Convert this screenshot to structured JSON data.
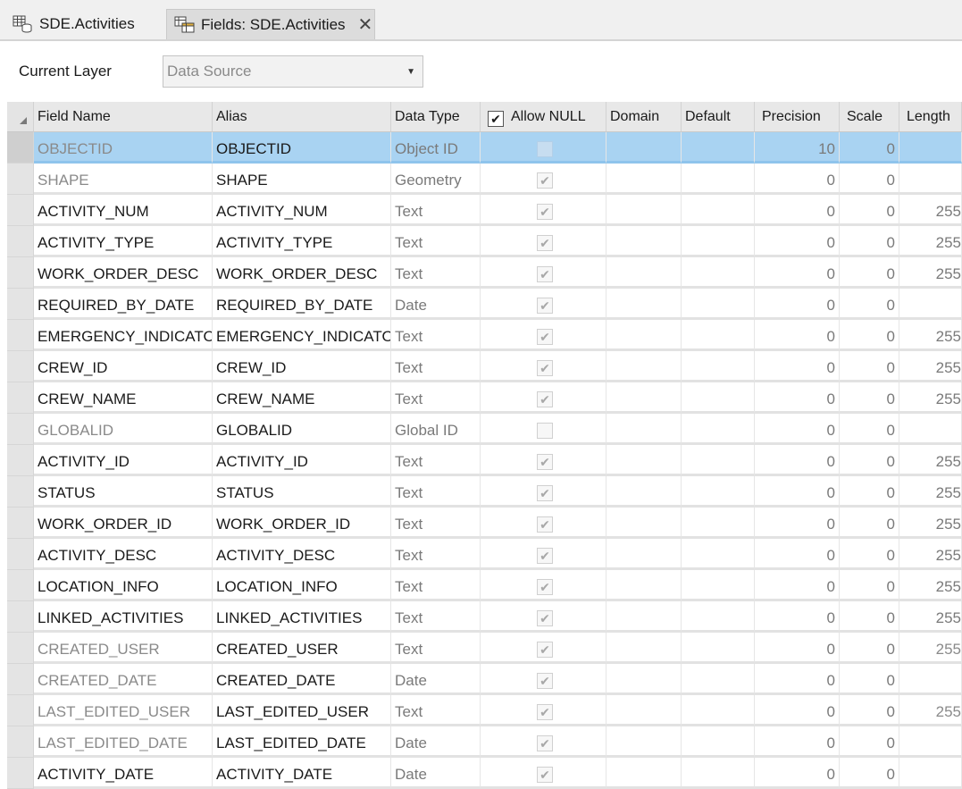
{
  "tabs": [
    {
      "label": "SDE.Activities",
      "icon": "table-icon",
      "active": false
    },
    {
      "label": "Fields: SDE.Activities",
      "icon": "fields-view-icon",
      "active": true,
      "close_icon": "close-icon"
    }
  ],
  "layer": {
    "label": "Current Layer",
    "value": "Data Source"
  },
  "grid": {
    "columns": [
      "Field Name",
      "Alias",
      "Data Type",
      "Allow NULL",
      "Domain",
      "Default",
      "Precision",
      "Scale",
      "Length"
    ],
    "header_allow_null_checked": true,
    "rows": [
      {
        "field": "OBJECTID",
        "alias": "OBJECTID",
        "type": "Object ID",
        "allow_null": false,
        "domain": "",
        "default": "",
        "precision": "10",
        "scale": "0",
        "length": "",
        "selected": true,
        "readonly": true
      },
      {
        "field": "SHAPE",
        "alias": "SHAPE",
        "type": "Geometry",
        "allow_null": true,
        "domain": "",
        "default": "",
        "precision": "0",
        "scale": "0",
        "length": "",
        "selected": false,
        "readonly": true
      },
      {
        "field": "ACTIVITY_NUM",
        "alias": "ACTIVITY_NUM",
        "type": "Text",
        "allow_null": true,
        "domain": "",
        "default": "",
        "precision": "0",
        "scale": "0",
        "length": "255",
        "selected": false,
        "readonly": false
      },
      {
        "field": "ACTIVITY_TYPE",
        "alias": "ACTIVITY_TYPE",
        "type": "Text",
        "allow_null": true,
        "domain": "",
        "default": "",
        "precision": "0",
        "scale": "0",
        "length": "255",
        "selected": false,
        "readonly": false
      },
      {
        "field": "WORK_ORDER_DESC",
        "alias": "WORK_ORDER_DESC",
        "type": "Text",
        "allow_null": true,
        "domain": "",
        "default": "",
        "precision": "0",
        "scale": "0",
        "length": "255",
        "selected": false,
        "readonly": false
      },
      {
        "field": "REQUIRED_BY_DATE",
        "alias": "REQUIRED_BY_DATE",
        "type": "Date",
        "allow_null": true,
        "domain": "",
        "default": "",
        "precision": "0",
        "scale": "0",
        "length": "",
        "selected": false,
        "readonly": false
      },
      {
        "field": "EMERGENCY_INDICATOR",
        "alias": "EMERGENCY_INDICATOR",
        "type": "Text",
        "allow_null": true,
        "domain": "",
        "default": "",
        "precision": "0",
        "scale": "0",
        "length": "255",
        "selected": false,
        "readonly": false
      },
      {
        "field": "CREW_ID",
        "alias": "CREW_ID",
        "type": "Text",
        "allow_null": true,
        "domain": "",
        "default": "",
        "precision": "0",
        "scale": "0",
        "length": "255",
        "selected": false,
        "readonly": false
      },
      {
        "field": "CREW_NAME",
        "alias": "CREW_NAME",
        "type": "Text",
        "allow_null": true,
        "domain": "",
        "default": "",
        "precision": "0",
        "scale": "0",
        "length": "255",
        "selected": false,
        "readonly": false
      },
      {
        "field": "GLOBALID",
        "alias": "GLOBALID",
        "type": "Global ID",
        "allow_null": false,
        "domain": "",
        "default": "",
        "precision": "0",
        "scale": "0",
        "length": "",
        "selected": false,
        "readonly": true
      },
      {
        "field": "ACTIVITY_ID",
        "alias": "ACTIVITY_ID",
        "type": "Text",
        "allow_null": true,
        "domain": "",
        "default": "",
        "precision": "0",
        "scale": "0",
        "length": "255",
        "selected": false,
        "readonly": false
      },
      {
        "field": "STATUS",
        "alias": "STATUS",
        "type": "Text",
        "allow_null": true,
        "domain": "",
        "default": "",
        "precision": "0",
        "scale": "0",
        "length": "255",
        "selected": false,
        "readonly": false
      },
      {
        "field": "WORK_ORDER_ID",
        "alias": "WORK_ORDER_ID",
        "type": "Text",
        "allow_null": true,
        "domain": "",
        "default": "",
        "precision": "0",
        "scale": "0",
        "length": "255",
        "selected": false,
        "readonly": false
      },
      {
        "field": "ACTIVITY_DESC",
        "alias": "ACTIVITY_DESC",
        "type": "Text",
        "allow_null": true,
        "domain": "",
        "default": "",
        "precision": "0",
        "scale": "0",
        "length": "255",
        "selected": false,
        "readonly": false
      },
      {
        "field": "LOCATION_INFO",
        "alias": "LOCATION_INFO",
        "type": "Text",
        "allow_null": true,
        "domain": "",
        "default": "",
        "precision": "0",
        "scale": "0",
        "length": "255",
        "selected": false,
        "readonly": false
      },
      {
        "field": "LINKED_ACTIVITIES",
        "alias": "LINKED_ACTIVITIES",
        "type": "Text",
        "allow_null": true,
        "domain": "",
        "default": "",
        "precision": "0",
        "scale": "0",
        "length": "255",
        "selected": false,
        "readonly": false
      },
      {
        "field": "CREATED_USER",
        "alias": "CREATED_USER",
        "type": "Text",
        "allow_null": true,
        "domain": "",
        "default": "",
        "precision": "0",
        "scale": "0",
        "length": "255",
        "selected": false,
        "readonly": true
      },
      {
        "field": "CREATED_DATE",
        "alias": "CREATED_DATE",
        "type": "Date",
        "allow_null": true,
        "domain": "",
        "default": "",
        "precision": "0",
        "scale": "0",
        "length": "",
        "selected": false,
        "readonly": true
      },
      {
        "field": "LAST_EDITED_USER",
        "alias": "LAST_EDITED_USER",
        "type": "Text",
        "allow_null": true,
        "domain": "",
        "default": "",
        "precision": "0",
        "scale": "0",
        "length": "255",
        "selected": false,
        "readonly": true
      },
      {
        "field": "LAST_EDITED_DATE",
        "alias": "LAST_EDITED_DATE",
        "type": "Date",
        "allow_null": true,
        "domain": "",
        "default": "",
        "precision": "0",
        "scale": "0",
        "length": "",
        "selected": false,
        "readonly": true
      },
      {
        "field": "ACTIVITY_DATE",
        "alias": "ACTIVITY_DATE",
        "type": "Date",
        "allow_null": true,
        "domain": "",
        "default": "",
        "precision": "0",
        "scale": "0",
        "length": "",
        "selected": false,
        "readonly": false
      }
    ]
  },
  "colors": {
    "selection": "#a9d3f2",
    "readonly_text": "#8a8a8a"
  }
}
